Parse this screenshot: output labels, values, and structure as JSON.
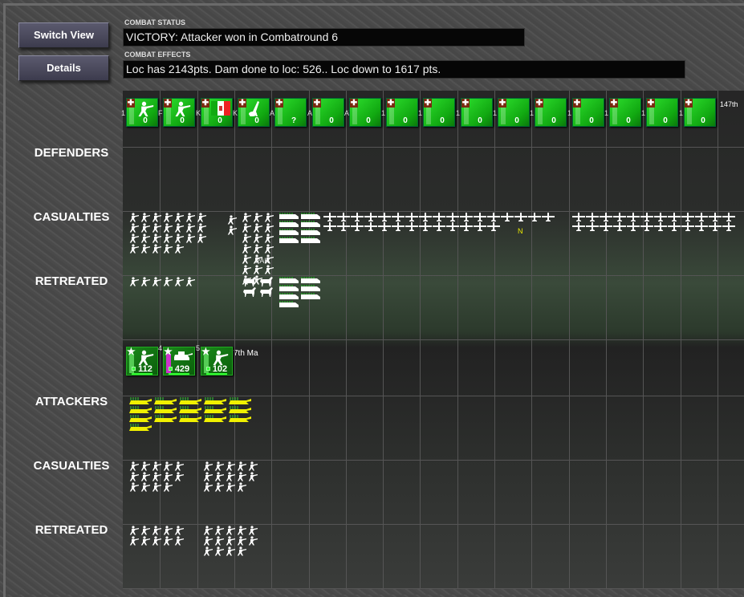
{
  "buttons": {
    "switch_view": "Switch View",
    "details": "Details"
  },
  "status": {
    "label": "COMBAT STATUS",
    "text": "VICTORY: Attacker won in Combatround  6"
  },
  "effects": {
    "label": "COMBAT EFFECTS",
    "text": "Loc has  2143pts. Dam done to loc: 526.. Loc down to 1617 pts."
  },
  "rows": {
    "defenders": "DEFENDERS",
    "def_casualties": "CASUALTIES",
    "def_retreated": "RETREATED",
    "attackers": "ATTACKERS",
    "att_casualties": "CASUALTIES",
    "att_retreated": "RETREATED"
  },
  "colors": {
    "counter_green": "#11a811",
    "attack_cas": "#e8e800",
    "bg": "#4a4a4a"
  },
  "defender_counters": [
    {
      "icon": "infantry-icon",
      "value": "0",
      "frag": "1"
    },
    {
      "icon": "infantry-icon",
      "value": "0",
      "frag": "F"
    },
    {
      "icon": "italian-flag-icon",
      "value": "0",
      "frag": "KIE"
    },
    {
      "icon": "mortar-icon",
      "value": "0",
      "frag": "KIE"
    },
    {
      "icon": "none",
      "value": "?",
      "frag": "AR"
    },
    {
      "icon": "none",
      "value": "0",
      "frag": "AR"
    },
    {
      "icon": "none",
      "value": "0",
      "frag": "AT"
    },
    {
      "icon": "none",
      "value": "0",
      "frag": "1"
    },
    {
      "icon": "none",
      "value": "0",
      "frag": "1"
    },
    {
      "icon": "none",
      "value": "0",
      "frag": "1"
    },
    {
      "icon": "none",
      "value": "0",
      "frag": "1"
    },
    {
      "icon": "none",
      "value": "0",
      "frag": "1"
    },
    {
      "icon": "none",
      "value": "0",
      "frag": "1"
    },
    {
      "icon": "none",
      "value": "0",
      "frag": "1"
    },
    {
      "icon": "none",
      "value": "0",
      "frag": "1"
    },
    {
      "icon": "none",
      "value": "0",
      "frag": "1"
    }
  ],
  "defender_tail_label": "147th",
  "attacker_counters": [
    {
      "icon": "infantry-icon",
      "value": "112",
      "frag": ""
    },
    {
      "icon": "tank-icon",
      "value": "429",
      "frag": "4"
    },
    {
      "icon": "infantry-icon",
      "value": "102",
      "frag": "5"
    }
  ],
  "attacker_tail_label": "7th Ma",
  "small_labels": {
    "pak": "PAK",
    "n": "N"
  },
  "clusters": [
    {
      "type": "soldier",
      "count": 26
    },
    {
      "type": "soldier",
      "count": 2
    },
    {
      "type": "soldier",
      "count": 20
    },
    {
      "type": "truck",
      "count": 8
    },
    {
      "type": "plane",
      "count": 30
    },
    {
      "type": "plane",
      "count": 24
    },
    {
      "type": "soldier",
      "count": 6
    },
    {
      "type": "horse",
      "count": 4
    },
    {
      "type": "truck",
      "count": 7
    },
    {
      "type": "tank",
      "count": 16
    },
    {
      "type": "soldier",
      "count": 14
    },
    {
      "type": "soldier",
      "count": 14
    },
    {
      "type": "soldier",
      "count": 10
    },
    {
      "type": "soldier",
      "count": 14
    }
  ]
}
